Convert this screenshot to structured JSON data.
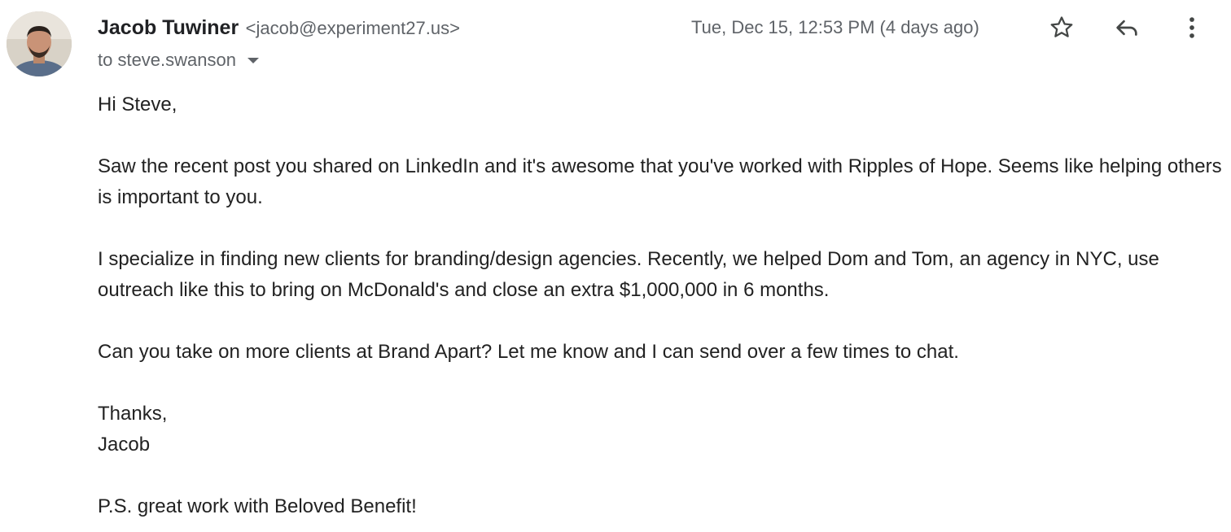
{
  "header": {
    "sender_name": "Jacob Tuwiner",
    "sender_email": "<jacob@experiment27.us>",
    "recipient": "to steve.swanson",
    "timestamp": "Tue, Dec 15, 12:53 PM (4 days ago)"
  },
  "icons": {
    "avatar": "sender-avatar",
    "dropdown": "chevron-down-icon",
    "star": "star-icon",
    "reply": "reply-icon",
    "more": "more-vert-icon"
  },
  "colors": {
    "text": "#222222",
    "secondary": "#5f6368"
  },
  "body": {
    "greeting": "Hi Steve,",
    "paragraph1": "Saw the recent post you shared on LinkedIn and it's awesome that you've worked with Ripples of Hope. Seems like helping others is important to you.",
    "paragraph2": "I specialize in finding new clients for branding/design agencies. Recently, we helped Dom and Tom, an agency in NYC, use outreach like this to bring on McDonald's and close an extra $1,000,000 in 6 months.",
    "paragraph3": "Can you take on more clients at Brand Apart? Let me know and I can send over a few times to chat.",
    "signoff": "Thanks,",
    "signature": "Jacob",
    "postscript": "P.S. great work with Beloved Benefit!"
  }
}
